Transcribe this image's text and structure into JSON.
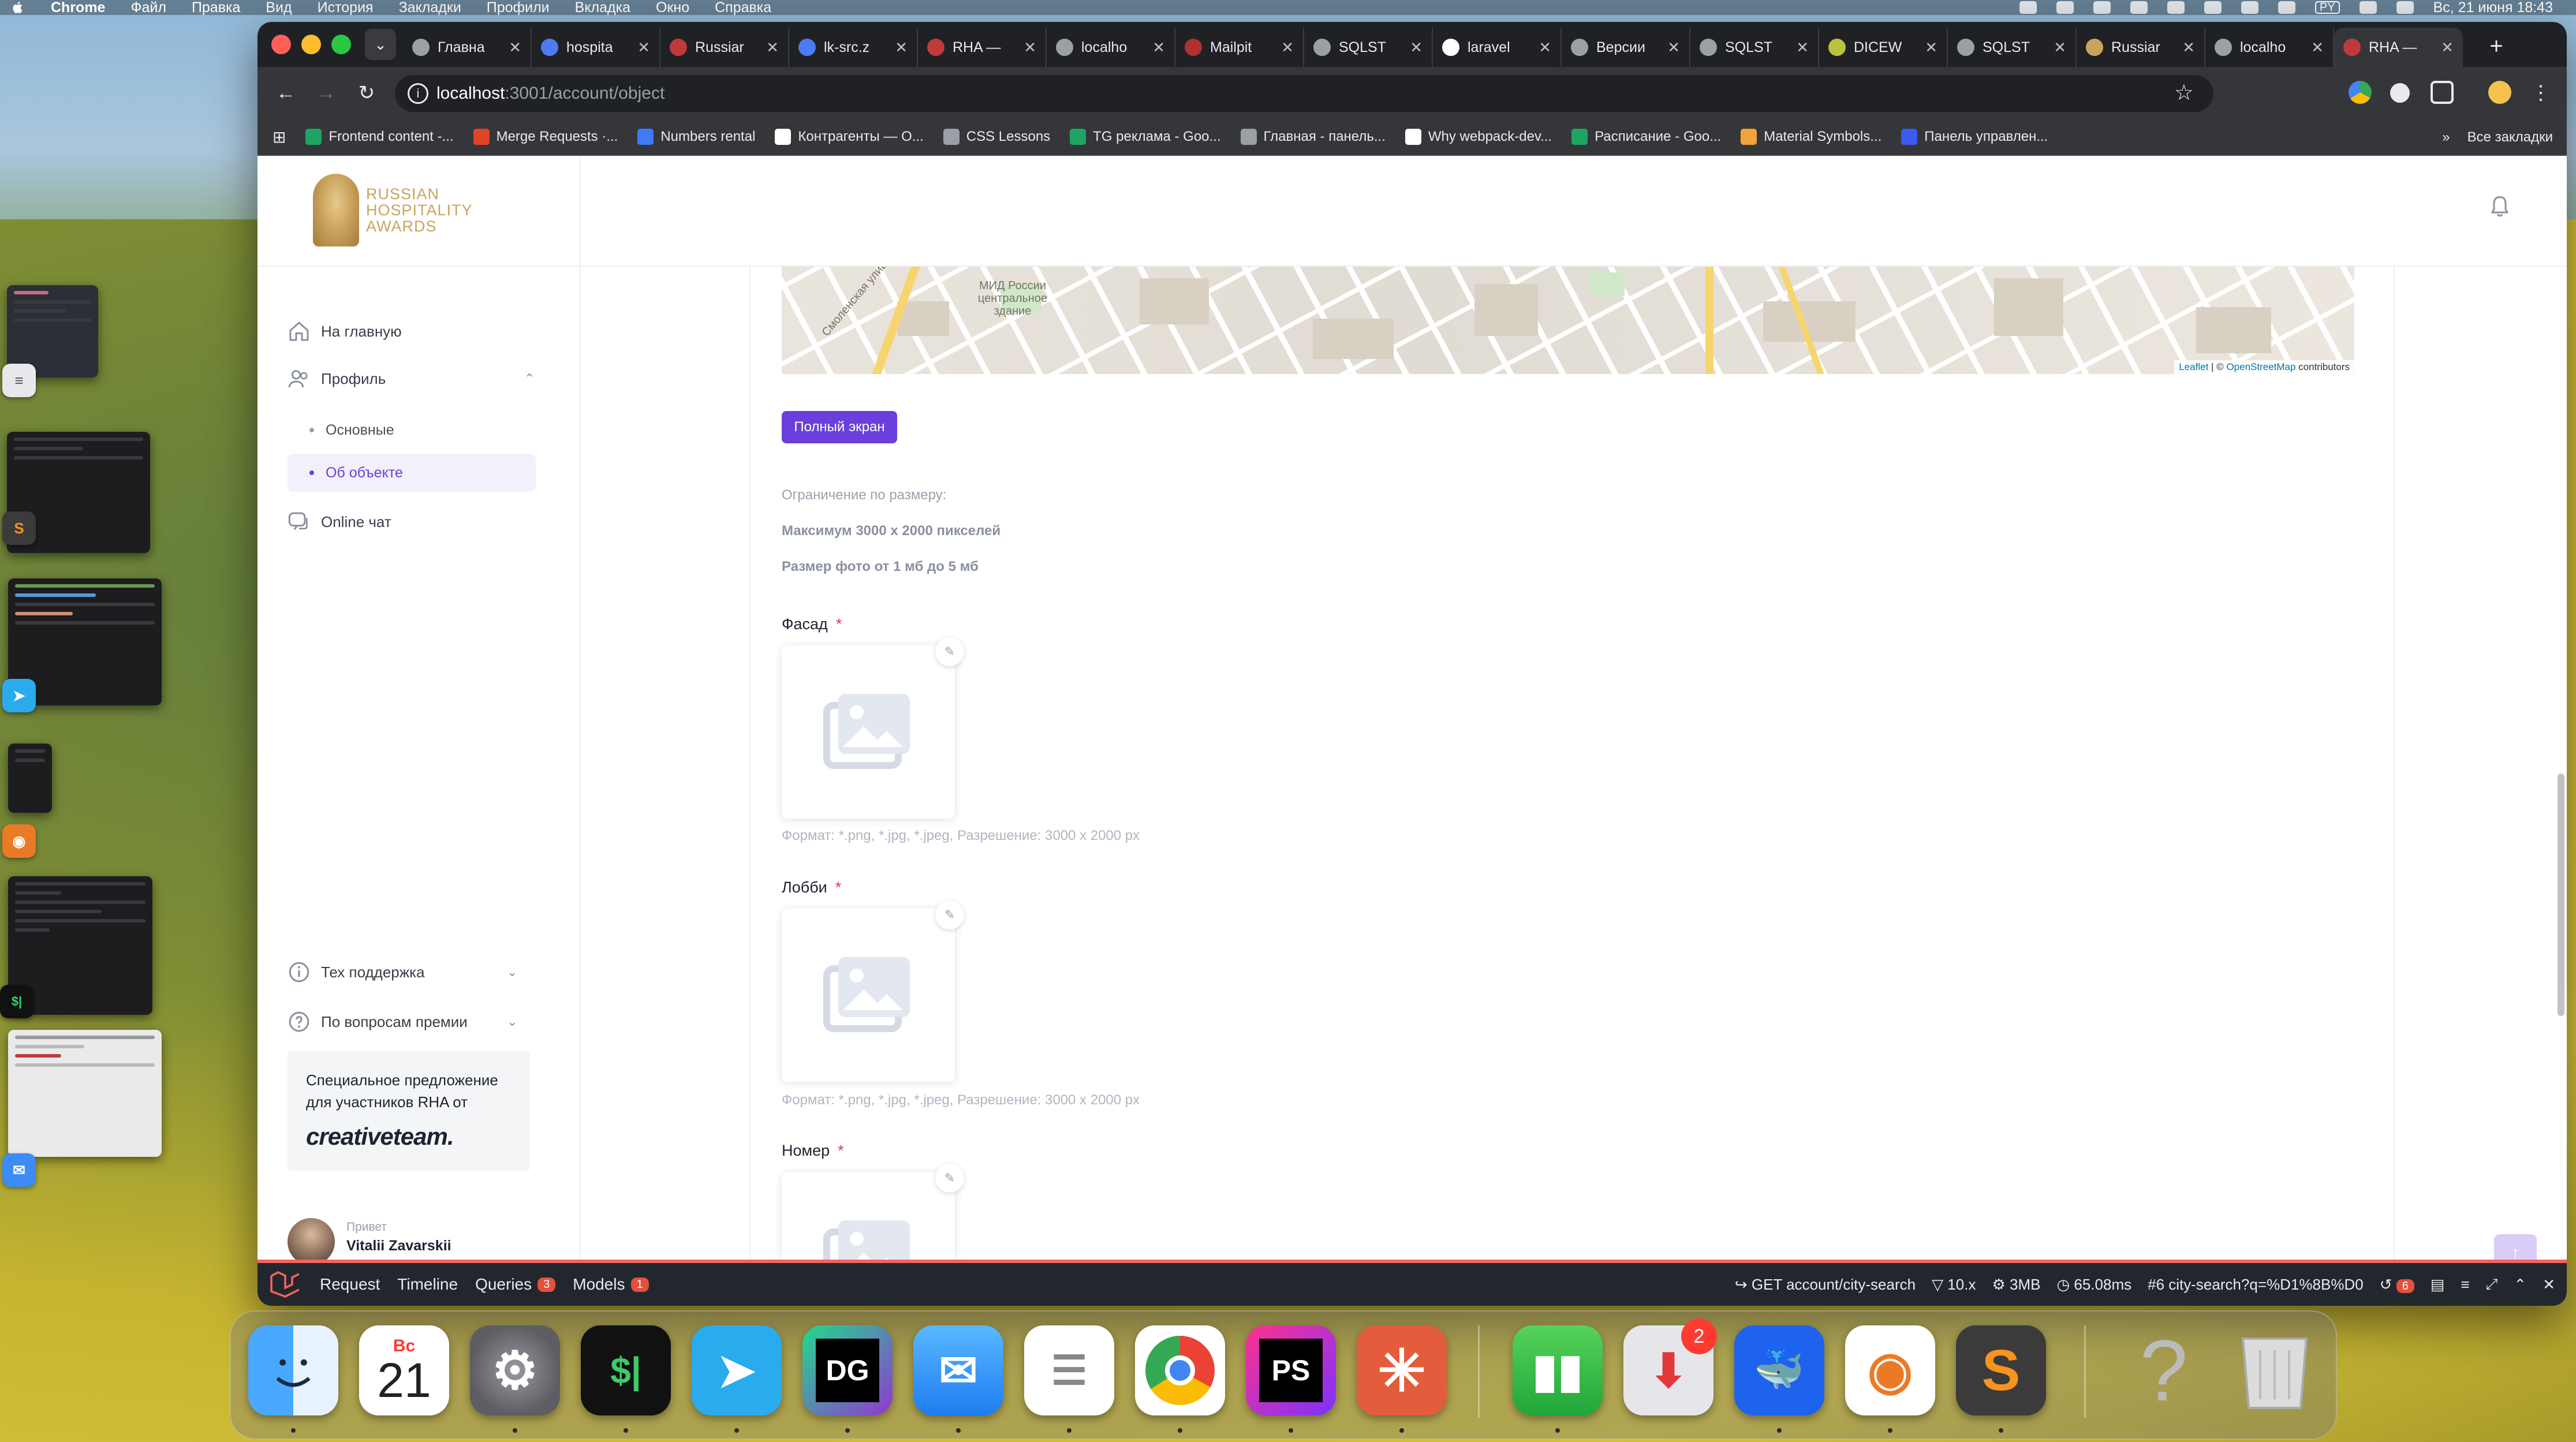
{
  "menubar": {
    "app": "Chrome",
    "items": [
      "Файл",
      "Правка",
      "Вид",
      "История",
      "Закладки",
      "Профили",
      "Вкладка",
      "Окно",
      "Справка"
    ],
    "lang": "PY",
    "datetime": "Вс, 21 июня  18:43"
  },
  "browser": {
    "tabs": [
      {
        "title": "Главна",
        "icon": "globe-icon",
        "color": "#9aa0a6"
      },
      {
        "title": "hospita",
        "icon": "gitlab-icon",
        "color": "#4c7bf3"
      },
      {
        "title": "Russiar",
        "icon": "rha-icon",
        "color": "#c03a3a"
      },
      {
        "title": "lk-src.z",
        "icon": "gitlab-icon",
        "color": "#4c7bf3"
      },
      {
        "title": "RHA —",
        "icon": "rha-icon",
        "color": "#c03a3a"
      },
      {
        "title": "localho",
        "icon": "globe-icon",
        "color": "#9aa0a6"
      },
      {
        "title": "Mailpit",
        "icon": "mailpit-icon",
        "color": "#b03030"
      },
      {
        "title": "SQLST",
        "icon": "globe-icon",
        "color": "#9aa0a6"
      },
      {
        "title": "laravel",
        "icon": "google-icon",
        "color": "#ffffff"
      },
      {
        "title": "Версии",
        "icon": "globe-icon",
        "color": "#9aa0a6"
      },
      {
        "title": "SQLST",
        "icon": "globe-icon",
        "color": "#9aa0a6"
      },
      {
        "title": "DICEW",
        "icon": "dicew-icon",
        "color": "#b8c23a"
      },
      {
        "title": "SQLST",
        "icon": "globe-icon",
        "color": "#9aa0a6"
      },
      {
        "title": "Russiar",
        "icon": "rha-icon",
        "color": "#c9a45f"
      },
      {
        "title": "localho",
        "icon": "globe-icon",
        "color": "#9aa0a6"
      },
      {
        "title": "RHA —",
        "icon": "rha-icon",
        "color": "#c03a3a",
        "active": true
      }
    ],
    "url_host": "localhost",
    "url_path": ":3001/account/object",
    "bookmarks": [
      {
        "label": "Frontend content -...",
        "color": "#1fa463"
      },
      {
        "label": "Merge Requests ·...",
        "color": "#e24329"
      },
      {
        "label": "Numbers rental",
        "color": "#3d7bf7"
      },
      {
        "label": "Контрагенты — О...",
        "color": "#ffffff"
      },
      {
        "label": "CSS Lessons",
        "color": "#9aa0a6"
      },
      {
        "label": "TG реклама - Goo...",
        "color": "#1fa463"
      },
      {
        "label": "Главная - панель...",
        "color": "#9aa0a6"
      },
      {
        "label": "Why webpack-dev...",
        "color": "#ffffff"
      },
      {
        "label": "Расписание - Goo...",
        "color": "#1fa463"
      },
      {
        "label": "Material Symbols...",
        "color": "#f2a33a"
      },
      {
        "label": "Панель управлен...",
        "color": "#3d5af1"
      }
    ],
    "all_bookmarks": "Все закладки"
  },
  "sidebar": {
    "logo_text": [
      "RUSSIAN",
      "HOSPITALITY",
      "AWARDS"
    ],
    "nav": {
      "home": "На главную",
      "profile": "Профиль",
      "sub_basic": "Основные",
      "sub_object": "Об объекте",
      "chat": "Online чат",
      "support": "Тех поддержка",
      "awards_questions": "По вопросам премии"
    },
    "promo": {
      "text": "Специальное предложение для участников RHA от",
      "brand": "creativeteam."
    },
    "user": {
      "greeting": "Привет",
      "name": "Vitalii Zavarskii"
    }
  },
  "main": {
    "map_labels": [
      "МИД России центральное здание",
      "Смоленская улица"
    ],
    "map_attribution_link1": "Leaflet",
    "map_attribution_sep": " | © ",
    "map_attribution_link2": "OpenStreetMap",
    "map_attribution_tail": " contributors",
    "fullscreen_button": "Полный экран",
    "size_limit_title": "Ограничение по размеру:",
    "size_limit_max": "Максимум 3000 x 2000 пикселей",
    "size_limit_weight": "Размер фото от 1 мб до 5 мб",
    "fields": [
      {
        "label": "Фасад",
        "required": "*",
        "format": "Формат: *.png, *.jpg, *.jpeg, Разрешение: 3000 x 2000 px"
      },
      {
        "label": "Лобби",
        "required": "*",
        "format": "Формат: *.png, *.jpg, *.jpeg, Разрешение: 3000 x 2000 px"
      },
      {
        "label": "Номер",
        "required": "*",
        "format": ""
      }
    ]
  },
  "debugbar": {
    "tabs": [
      {
        "label": "Request",
        "badge": ""
      },
      {
        "label": "Timeline",
        "badge": ""
      },
      {
        "label": "Queries",
        "badge": "3"
      },
      {
        "label": "Models",
        "badge": "1"
      }
    ],
    "route": "GET account/city-search",
    "php": "10.x",
    "memory": "3MB",
    "time": "65.08ms",
    "request": "#6 city-search?q=%D1%8B%D0",
    "history_badge": "6"
  },
  "dock": {
    "calendar_day": "Вс",
    "calendar_date": "21",
    "badge": "2",
    "apps": [
      "Finder",
      "Calendar",
      "System Settings",
      "iTerm",
      "Telegram",
      "DataGrip",
      "Mail",
      "Reminders",
      "Chrome",
      "PhpStorm",
      "Perplexity",
      "Numbers",
      "Installer",
      "Docker",
      "OpenVPN",
      "Sublime Text",
      "Help",
      "Trash"
    ]
  }
}
